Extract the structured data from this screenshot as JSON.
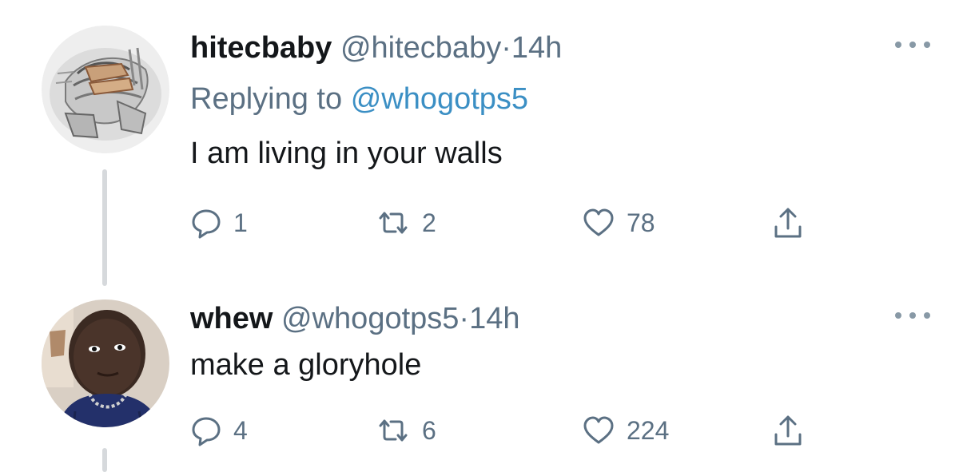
{
  "tweets": [
    {
      "display_name": "hitecbaby",
      "handle": "@hitecbaby",
      "separator": "·",
      "time": "14h",
      "replying_prefix": "Replying to",
      "replying_to": "@whogotps5",
      "text": "I am living in your walls",
      "reply_count": "1",
      "retweet_count": "2",
      "like_count": "78",
      "avatar_icon": "mechanical-figure-avatar"
    },
    {
      "display_name": "whew",
      "handle": "@whogotps5",
      "separator": "·",
      "time": "14h",
      "text": "make a gloryhole",
      "reply_count": "4",
      "retweet_count": "6",
      "like_count": "224",
      "avatar_icon": "person-avatar"
    }
  ],
  "colors": {
    "text": "#14171a",
    "secondary": "#5b7083",
    "mention": "#3b8fc4",
    "thread_line": "#d6d9dc"
  },
  "icons": {
    "reply": "speech-bubble-icon",
    "retweet": "retweet-arrows-icon",
    "like": "heart-icon",
    "share": "share-upload-icon",
    "more": "more-dots-icon"
  }
}
